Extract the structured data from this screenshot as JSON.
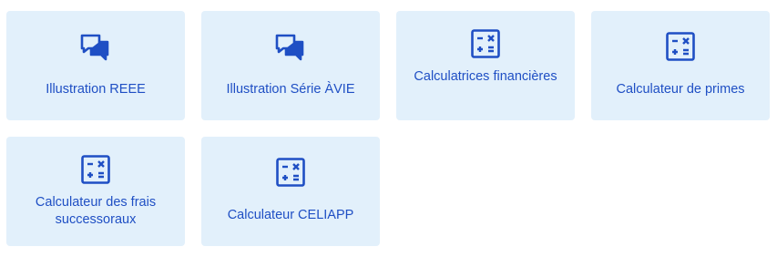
{
  "tiles": [
    {
      "label": "Illustration REEE",
      "icon": "chat-bubbles-icon"
    },
    {
      "label": "Illustration Série ÀVIE",
      "icon": "chat-bubbles-icon"
    },
    {
      "label": "Calculatrices financières",
      "icon": "calculator-icon"
    },
    {
      "label": "Calculateur de primes",
      "icon": "calculator-icon"
    },
    {
      "label": "Calculateur des frais successoraux",
      "icon": "calculator-icon"
    },
    {
      "label": "Calculateur CELIAPP",
      "icon": "calculator-icon"
    }
  ],
  "colors": {
    "tile_background": "#e2f0fb",
    "accent": "#1f4fc4"
  }
}
